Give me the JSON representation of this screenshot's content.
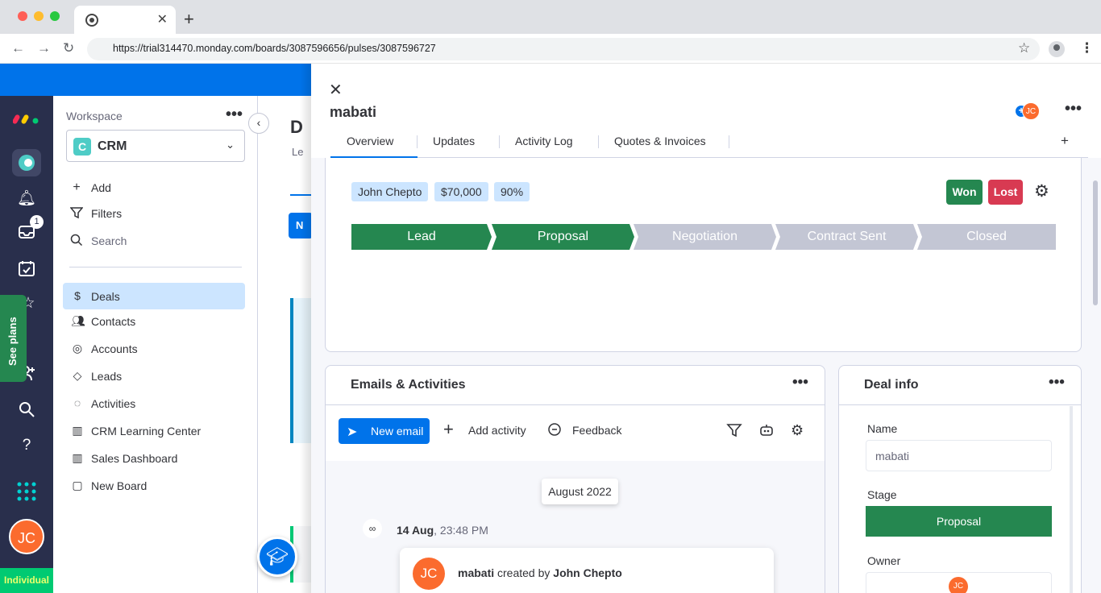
{
  "browser": {
    "tab_title": "",
    "url": "https://trial314470.monday.com/boards/3087596656/pulses/3087596727"
  },
  "rail": {
    "inbox_badge": "1",
    "see_plans": "See plans",
    "avatar": "JC",
    "plan": "Individual"
  },
  "workspace": {
    "label": "Workspace",
    "badge_letter": "C",
    "name": "CRM",
    "actions": {
      "add": "Add",
      "filters": "Filters",
      "search": "Search"
    },
    "items": [
      {
        "label": "Deals",
        "icon": "dollar-icon"
      },
      {
        "label": "Contacts",
        "icon": "contacts-icon"
      },
      {
        "label": "Accounts",
        "icon": "accounts-icon"
      },
      {
        "label": "Leads",
        "icon": "leads-icon"
      },
      {
        "label": "Activities",
        "icon": "activities-icon"
      },
      {
        "label": "CRM Learning Center",
        "icon": "dashboard-icon"
      },
      {
        "label": "Sales Dashboard",
        "icon": "dashboard-icon"
      },
      {
        "label": "New Board",
        "icon": "board-icon"
      }
    ]
  },
  "board": {
    "title_fragment": "D",
    "sub_fragment": "Le",
    "new_fragment": "N"
  },
  "panel": {
    "title": "mabati",
    "subscriber": "JC",
    "tabs": [
      "Overview",
      "Updates",
      "Activity Log",
      "Quotes & Invoices"
    ],
    "chips": [
      "John Chepto",
      "$70,000",
      "90%"
    ],
    "won": "Won",
    "lost": "Lost",
    "stages": [
      {
        "label": "Lead",
        "done": true
      },
      {
        "label": "Proposal",
        "done": true
      },
      {
        "label": "Negotiation",
        "done": false
      },
      {
        "label": "Contract Sent",
        "done": false
      },
      {
        "label": "Closed",
        "done": false
      }
    ],
    "emails": {
      "title": "Emails & Activities",
      "new_email": "New email",
      "add_activity": "Add activity",
      "feedback": "Feedback",
      "month": "August 2022",
      "event_date": "14 Aug",
      "event_time": ", 23:48 PM",
      "event_avatar": "JC",
      "event_item": "mabati",
      "event_mid": " created by ",
      "event_user": "John Chepto"
    },
    "deal_info": {
      "title": "Deal info",
      "name_label": "Name",
      "name_value": "mabati",
      "stage_label": "Stage",
      "stage_value": "Proposal",
      "owner_label": "Owner",
      "owner_avatar": "JC"
    }
  },
  "colors": {
    "accent": "#0073ea",
    "rail": "#292f4c",
    "done_stage": "#258750",
    "lost": "#d83a52",
    "avatar": "#fb6b2e"
  }
}
